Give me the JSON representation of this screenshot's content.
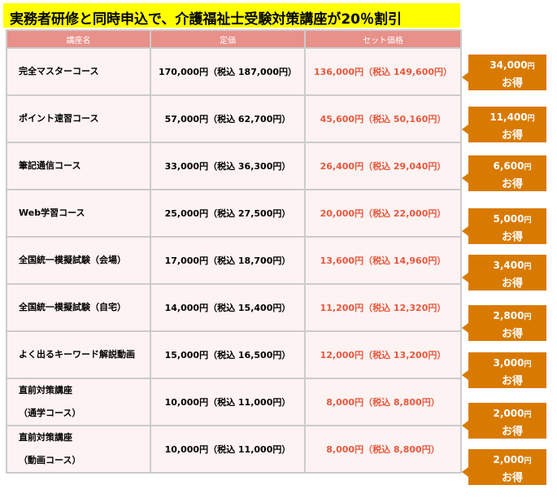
{
  "title": "実務者研修と同時申込で、介護福祉士受験対策講座が20％割引",
  "headers": [
    "講座名",
    "定価",
    "セット価格"
  ],
  "rows": [
    {
      "name": "完全マスターコース",
      "name_sub": "",
      "list_price": "170,000円（税込 187,000円）",
      "set_price": "136,000円（税込 149,600円）",
      "saving": "34,000",
      "unit": "円",
      "label": "お得"
    },
    {
      "name": "ポイント速習コース",
      "name_sub": "",
      "list_price": "57,000円（税込 62,700円）",
      "set_price": "45,600円（税込 50,160円）",
      "saving": "11,400",
      "unit": "円",
      "label": "お得"
    },
    {
      "name": "筆記通信コース",
      "name_sub": "",
      "list_price": "33,000円（税込 36,300円）",
      "set_price": "26,400円（税込 29,040円）",
      "saving": "6,600",
      "unit": "円",
      "label": "お得"
    },
    {
      "name": "Web学習コース",
      "name_sub": "",
      "list_price": "25,000円（税込 27,500円）",
      "set_price": "20,000円（税込 22,000円）",
      "saving": "5,000",
      "unit": "円",
      "label": "お得"
    },
    {
      "name": "全国統一模擬試験（会場）",
      "name_sub": "",
      "list_price": "17,000円（税込 18,700円）",
      "set_price": "13,600円（税込 14,960円）",
      "saving": "3,400",
      "unit": "円",
      "label": "お得"
    },
    {
      "name": "全国統一模擬試験（自宅）",
      "name_sub": "",
      "list_price": "14,000円（税込 15,400円）",
      "set_price": "11,200円（税込 12,320円）",
      "saving": "2,800",
      "unit": "円",
      "label": "お得"
    },
    {
      "name": "よく出るキーワード解説動画",
      "name_sub": "",
      "list_price": "15,000円（税込 16,500円）",
      "set_price": "12,000円（税込 13,200円）",
      "saving": "3,000",
      "unit": "円",
      "label": "お得"
    },
    {
      "name": "直前対策講座",
      "name_sub": "（通学コース）",
      "list_price": "10,000円（税込 11,000円）",
      "set_price": "8,000円（税込 8,800円）",
      "saving": "2,000",
      "unit": "円",
      "label": "お得"
    },
    {
      "name": "直前対策講座",
      "name_sub": "（動画コース）",
      "list_price": "10,000円（税込 11,000円）",
      "set_price": "8,000円（税込 8,800円）",
      "saving": "2,000",
      "unit": "円",
      "label": "お得"
    }
  ],
  "colors": {
    "banner": "#ffff00",
    "header": "#e8908a",
    "cell": "#fdf3f2",
    "set_price": "#e8573d",
    "badge": "#d97a00"
  }
}
